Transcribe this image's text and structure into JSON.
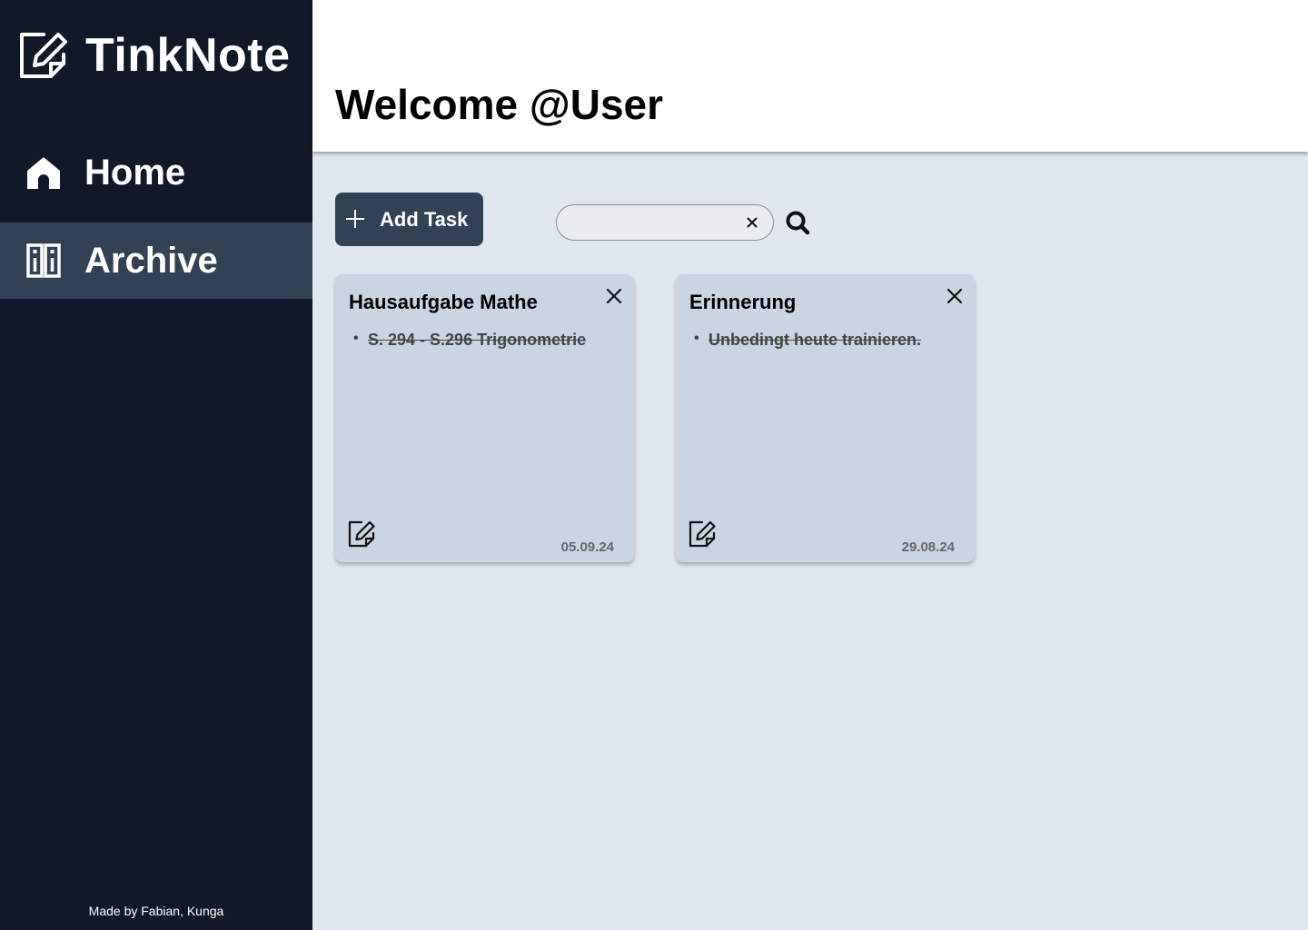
{
  "app": {
    "name": "TinkNote",
    "logo_icon": "edit-note-icon"
  },
  "sidebar": {
    "items": [
      {
        "label": "Home",
        "icon": "home-icon",
        "active": false
      },
      {
        "label": "Archive",
        "icon": "archive-icon",
        "active": true
      }
    ],
    "credits": "Made by Fabian, Kunga"
  },
  "header": {
    "title": "Welcome @User"
  },
  "toolbar": {
    "add_label": "Add Task",
    "search_value": "",
    "search_placeholder": ""
  },
  "cards": [
    {
      "title": "Hausaufgabe Mathe",
      "items": [
        "S. 294 - S.296 Trigonometrie"
      ],
      "date": "05.09.24"
    },
    {
      "title": "Erinnerung",
      "items": [
        "Unbedingt heute trainieren."
      ],
      "date": "29.08.24"
    }
  ],
  "colors": {
    "sidebar_bg": "#111827",
    "active_item_bg": "#334155",
    "main_bg": "#e1e7ef",
    "card_bg": "#cbd5e1",
    "button_bg": "#334155"
  }
}
